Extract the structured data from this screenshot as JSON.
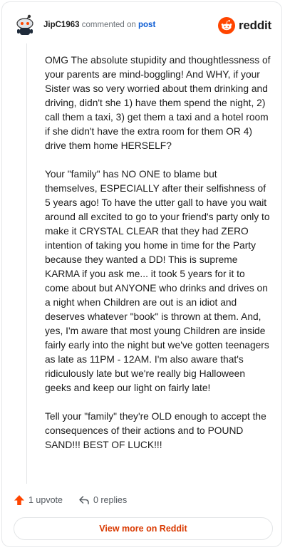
{
  "comment": {
    "username": "JipC1963",
    "action_text": "commented on",
    "post_link": "post",
    "paragraphs": [
      "OMG The absolute stupidity and thoughtlessness of your parents are mind-boggling! And WHY, if your Sister was so very worried about them drinking and driving, didn't she 1) have them spend the night, 2) call them a taxi, 3) get them a taxi and a hotel room if she didn't have the extra room for them OR 4) drive them home HERSELF?",
      "Your \"family\" has NO ONE to blame but themselves, ESPECIALLY after their selfishness of 5 years ago! To have the utter gall to have you wait around all excited to go to your friend's party only to make it CRYSTAL CLEAR that they had ZERO intention of taking you home in time for the Party because they wanted a DD! This is supreme KARMA if you ask me... it took 5 years for it to come about but ANYONE who drinks and drives on a night when Children are out is an idiot and deserves whatever \"book\" is thrown at them. And, yes, I'm aware that most young Children are inside fairly early into the night but we've gotten teenagers as late as 11PM - 12AM. I'm also aware that's ridiculously late but we're really big Halloween geeks and keep our light on fairly late!",
      "Tell your \"family\" they're OLD enough to accept the consequences of their actions and to POUND SAND!!! BEST OF LUCK!!!"
    ]
  },
  "brand": {
    "wordmark": "reddit",
    "icon": "reddit-logo-icon",
    "color": "#ff4500"
  },
  "actions": {
    "upvote_label": "1 upvote",
    "upvote_icon": "upvote-arrow-icon",
    "reply_label": "0 replies",
    "reply_icon": "reply-arrow-icon"
  },
  "footer": {
    "view_more_label": "View more on Reddit"
  },
  "colors": {
    "accent": "#ff4500",
    "link": "#0b5bd3",
    "cta": "#d93900"
  }
}
